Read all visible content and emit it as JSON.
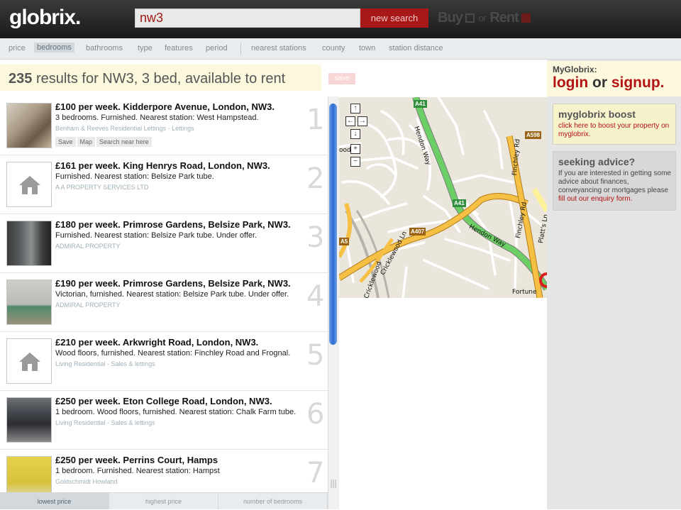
{
  "header": {
    "logo": "globrix.",
    "search_value": "nw3",
    "search_button": "new search",
    "buy_label": "Buy",
    "or_label": "or",
    "rent_label": "Rent"
  },
  "filters": {
    "left": [
      "price",
      "bedrooms",
      "bathrooms",
      "type",
      "features",
      "period"
    ],
    "right": [
      "nearest stations",
      "county",
      "town",
      "station distance"
    ],
    "active": "bedrooms"
  },
  "results": {
    "count": "235",
    "summary": "results for NW3, 3 bed, available to rent",
    "save_label": "save"
  },
  "listings": [
    {
      "title": "£100 per week. Kidderpore Avenue, London, NW3.",
      "desc": "3 bedrooms. Furnished. Nearest station: West Hampstead.",
      "agent": "Benham & Reeves Residential Lettings - Lettings",
      "number": "1",
      "thumb": "photo1",
      "actions": [
        "Save",
        "Map",
        "Search near here"
      ]
    },
    {
      "title": "£161 per week. King Henrys Road, London, NW3.",
      "desc": "Furnished. Nearest station: Belsize Park tube.",
      "agent": "A A PROPERTY SERVICES LTD",
      "number": "2",
      "thumb": "house-icon"
    },
    {
      "title": "£180 per week. Primrose Gardens, Belsize Park, NW3.",
      "desc": "Furnished. Nearest station: Belsize Park tube. Under offer.",
      "agent": "ADMIRAL PROPERTY",
      "number": "3",
      "thumb": "photo2"
    },
    {
      "title": "£190 per week. Primrose Gardens, Belsize Park, NW3.",
      "desc": "Victorian, furnished. Nearest station: Belsize Park tube. Under offer.",
      "agent": "ADMIRAL PROPERTY",
      "number": "4",
      "thumb": "photo3"
    },
    {
      "title": "£210 per week. Arkwright Road, London, NW3.",
      "desc": "Wood floors, furnished. Nearest station: Finchley Road and Frognal.",
      "agent": "Living Residential - Sales & lettings",
      "number": "5",
      "thumb": "house-icon"
    },
    {
      "title": "£250 per week. Eton College Road, London, NW3.",
      "desc": "1 bedroom. Wood floors, furnished. Nearest station: Chalk Farm tube.",
      "agent": "Living Residential - Sales & lettings",
      "number": "6",
      "thumb": "photo4"
    },
    {
      "title": "£250 per week. Perrins Court, Hamps",
      "desc": "1 bedroom. Furnished. Nearest station: Hampst",
      "agent": "Goldschmidt Howland",
      "number": "7",
      "thumb": "photo5"
    }
  ],
  "sort": {
    "options": [
      "lowest price",
      "highest price",
      "number of bedrooms"
    ],
    "active": "lowest price"
  },
  "map": {
    "controls": [
      "↑",
      "←",
      "→",
      "↓",
      "+",
      "−"
    ],
    "road_labels": [
      "Hendon Way",
      "Finchley Rd",
      "Hendon Way",
      "Finchley Rd",
      "Cricklewood Ln",
      "Cricklewood",
      "Platt's Ln",
      "ood",
      "Fortune"
    ],
    "shields": [
      "A41",
      "A598",
      "A41",
      "A407",
      "A5"
    ]
  },
  "sidebar": {
    "my_label": "MyGlobrix:",
    "login": "login",
    "or": "or",
    "signup": "signup",
    "dot": ".",
    "boost_title": "myglobrix boost",
    "boost_text": "click here to boost your property on myglobrix.",
    "advice_title": "seeking advice?",
    "advice_text": "If you are interested in getting some advice about finances, conveyancing or mortgages please",
    "advice_link": "fill out our enquiry form."
  },
  "colors": {
    "brand_red": "#b31313",
    "header_dark": "#1a1a1a",
    "highlight_yellow": "#fbf8dd"
  }
}
